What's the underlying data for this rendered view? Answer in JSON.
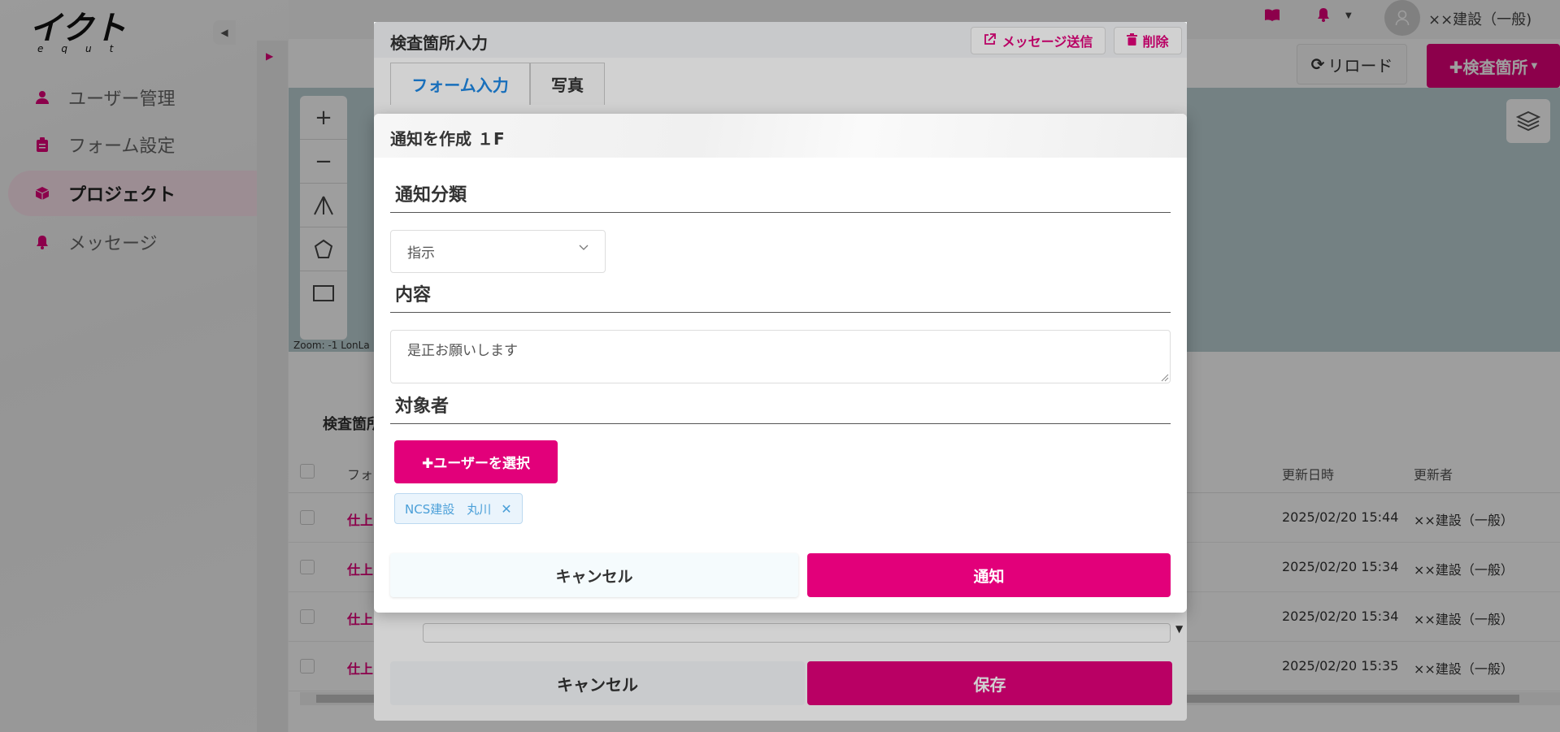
{
  "app": {
    "logo_text": "equt"
  },
  "sidebar": {
    "items": [
      {
        "label": "ユーザー管理",
        "icon": "user-icon"
      },
      {
        "label": "フォーム設定",
        "icon": "clipboard-icon"
      },
      {
        "label": "プロジェクト",
        "icon": "cube-icon",
        "active": true
      },
      {
        "label": "メッセージ",
        "icon": "bell-icon"
      }
    ]
  },
  "header": {
    "user_name": "××建設（一般)"
  },
  "toolbar": {
    "reload_label": "リロード",
    "add_location_label": "✚検査箇所"
  },
  "map": {
    "zoom_text": "Zoom: -1 LonLa"
  },
  "list": {
    "title": "検査箇所",
    "columns": {
      "form": "フォ",
      "updated_at": "更新日時",
      "updated_by": "更新者"
    },
    "rows": [
      {
        "link": "仕上",
        "updated_at": "2025/02/20 15:44",
        "updated_by": "××建設（一般）"
      },
      {
        "link": "仕上",
        "updated_at": "2025/02/20 15:34",
        "updated_by": "××建設（一般）"
      },
      {
        "link": "仕上",
        "updated_at": "2025/02/20 15:34",
        "updated_by": "××建設（一般）"
      },
      {
        "link": "仕上",
        "updated_at": "2025/02/20 15:35",
        "updated_by": "××建設（一般）"
      }
    ]
  },
  "inspection_modal": {
    "title": "検査箇所入力",
    "message_button": "メッセージ送信",
    "delete_button": "削除",
    "tabs": [
      "フォーム入力",
      "写真"
    ],
    "cancel_label": "キャンセル",
    "save_label": "保存"
  },
  "notify_modal": {
    "title": "通知を作成 １F",
    "category_label": "通知分類",
    "category_value": "指示",
    "content_label": "内容",
    "content_value": "是正お願いします",
    "target_label": "対象者",
    "select_user_label": "✚ユーザーを選択",
    "selected_users": [
      "NCS建設　丸川"
    ],
    "cancel_label": "キャンセル",
    "notify_label": "通知"
  },
  "colors": {
    "accent": "#e2007a",
    "tab_active": "#1e88e5",
    "chip_text": "#4a9fd8"
  }
}
